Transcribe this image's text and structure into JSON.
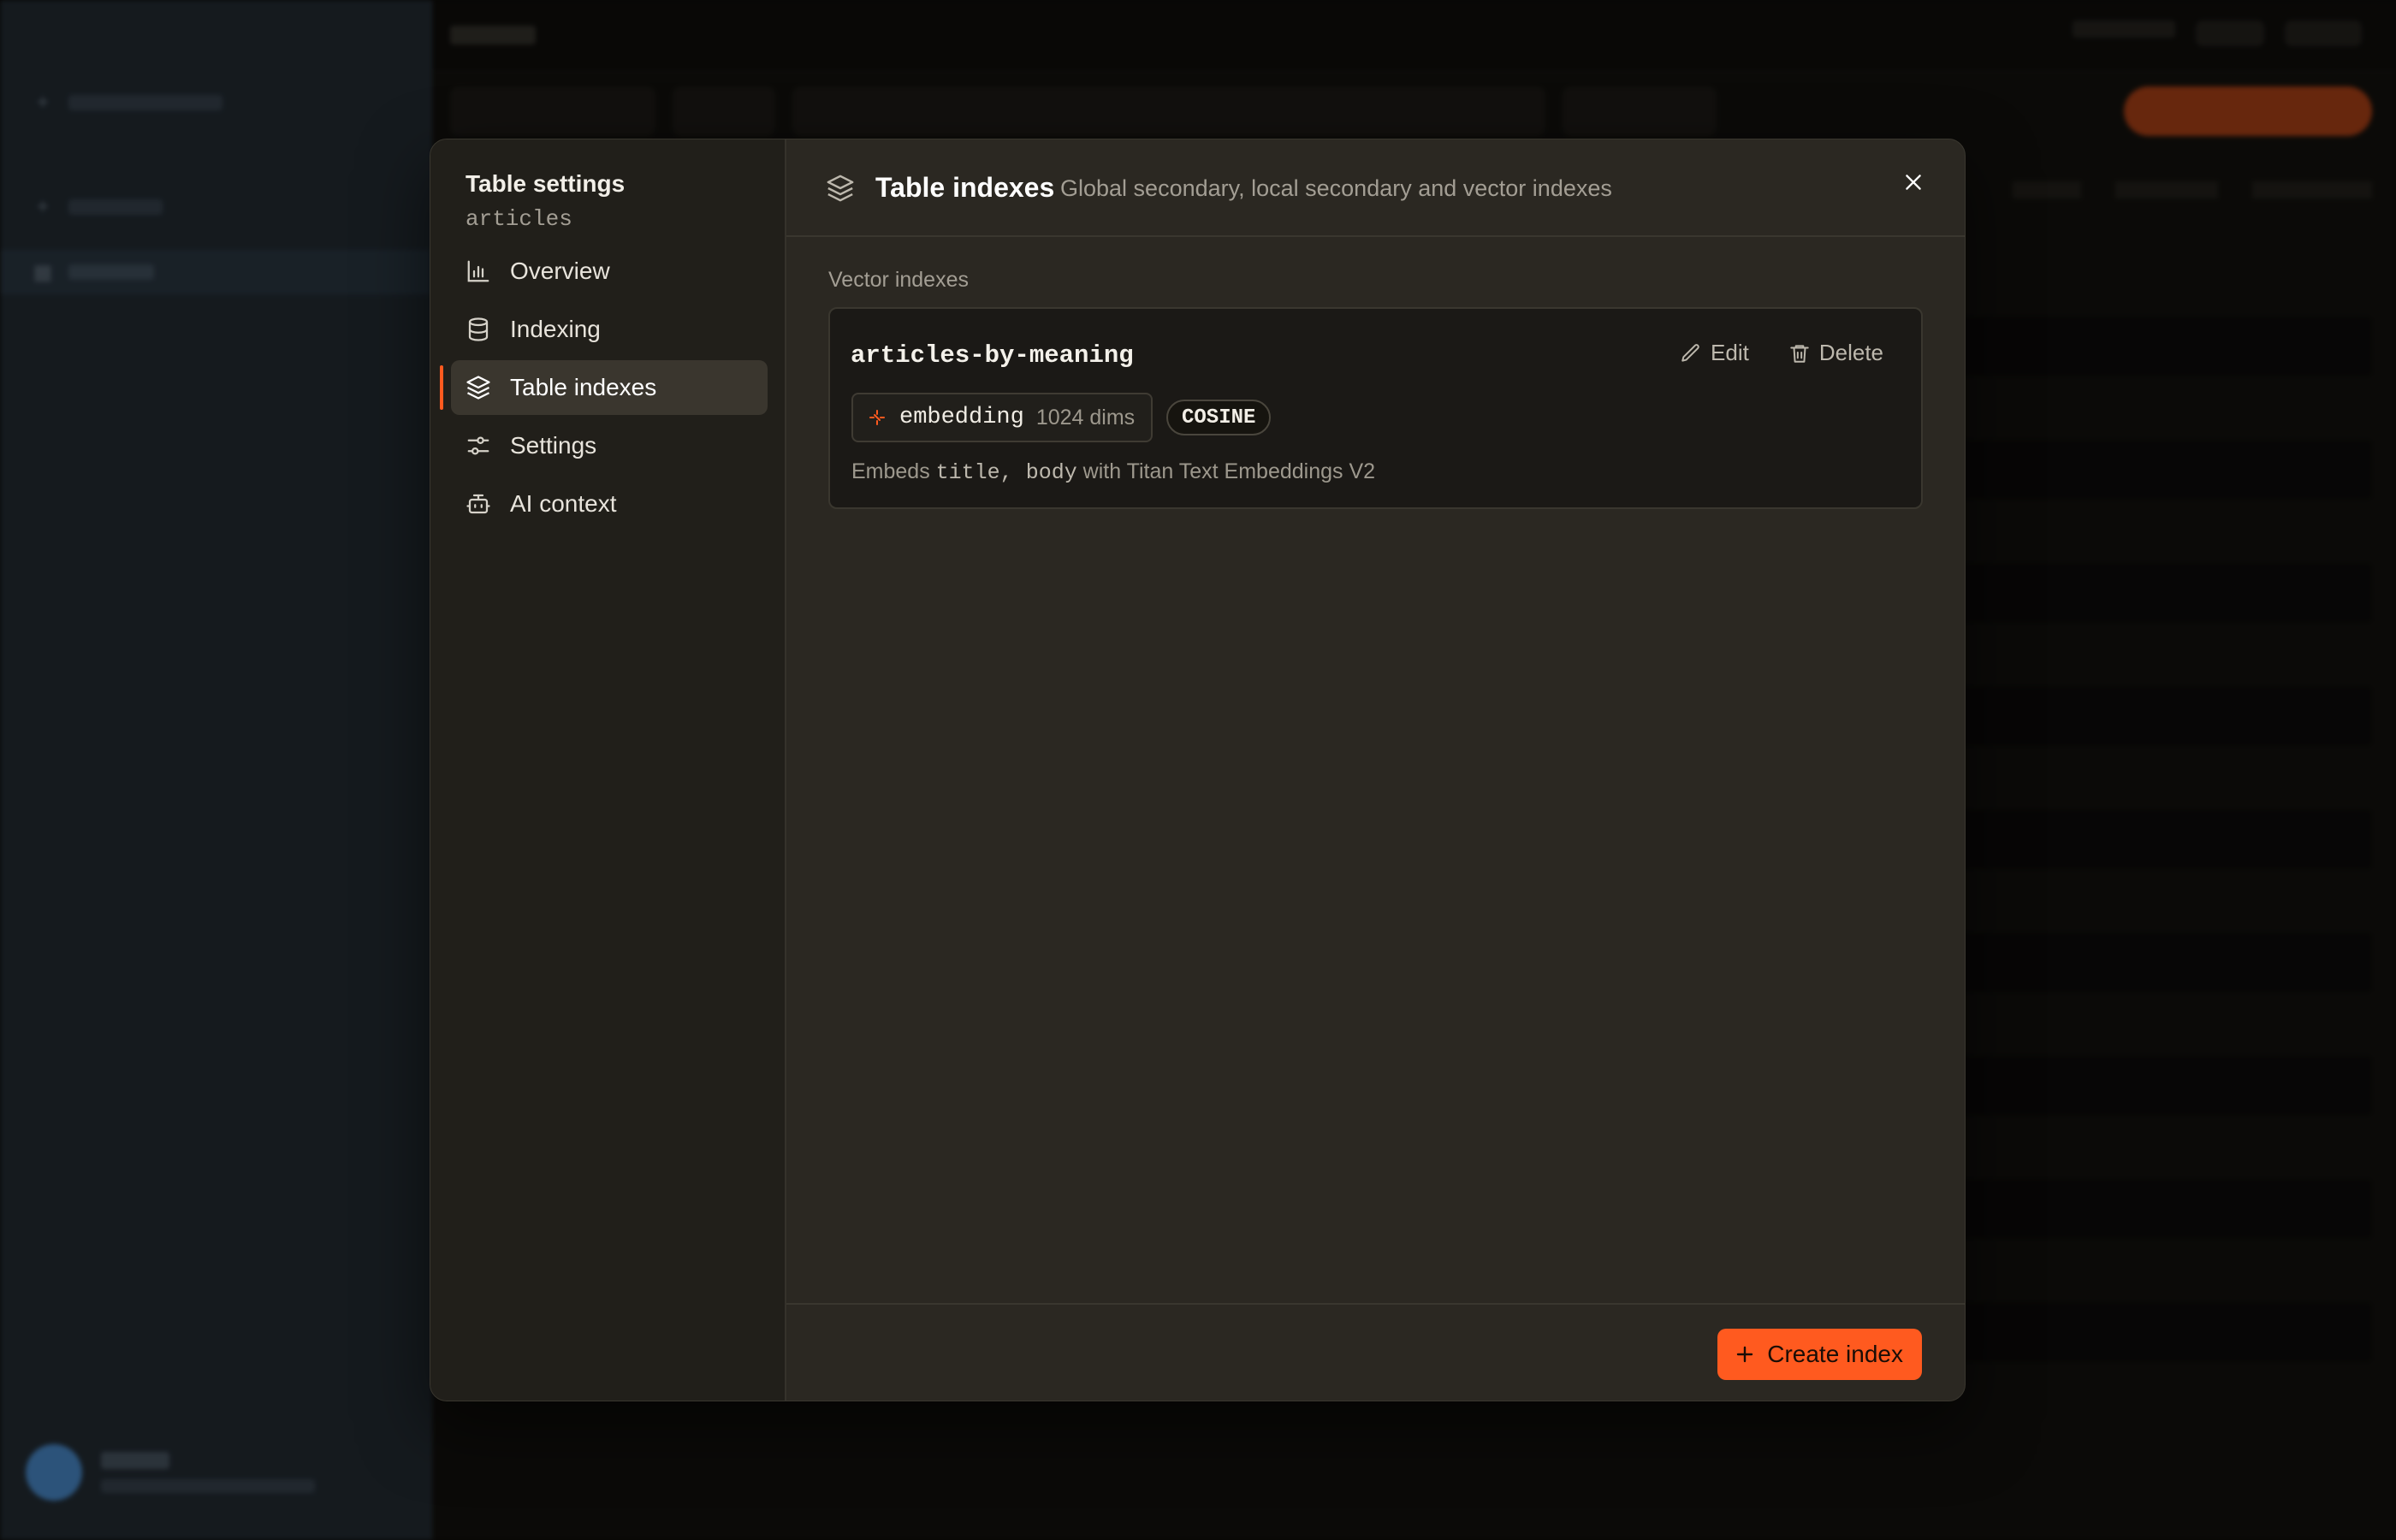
{
  "colors": {
    "accent": "#ff5a1f",
    "modal_bg": "#2b2822",
    "nav_bg": "#211f1a",
    "card_bg": "#1b1916"
  },
  "modal": {
    "nav": {
      "title": "Table settings",
      "subtitle": "articles",
      "items": [
        {
          "label": "Overview",
          "icon": "bar-chart-icon"
        },
        {
          "label": "Indexing",
          "icon": "database-icon"
        },
        {
          "label": "Table indexes",
          "icon": "layers-icon",
          "active": true
        },
        {
          "label": "Settings",
          "icon": "sliders-icon"
        },
        {
          "label": "AI context",
          "icon": "robot-icon"
        }
      ]
    },
    "header": {
      "title": "Table indexes",
      "description": "Global secondary, local secondary and vector indexes",
      "icon": "layers-icon"
    },
    "section_label": "Vector indexes",
    "index_card": {
      "name": "articles-by-meaning",
      "edit_label": "Edit",
      "delete_label": "Delete",
      "field": "embedding",
      "dims": "1024 dims",
      "metric": "COSINE",
      "embeds_prefix": "Embeds",
      "embeds_fields": "title, body",
      "embeds_suffix": "with Titan Text Embeddings V2"
    },
    "footer": {
      "create_label": "Create index"
    }
  }
}
